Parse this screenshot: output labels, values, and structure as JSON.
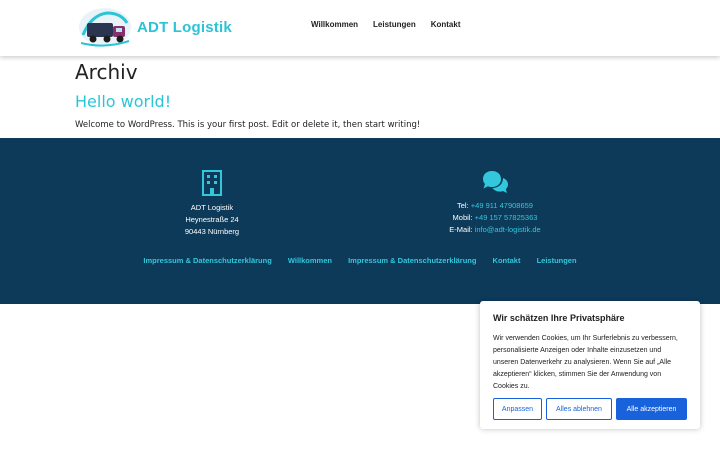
{
  "header": {
    "brand": "ADT Logistik",
    "nav": [
      {
        "label": "Willkommen"
      },
      {
        "label": "Leistungen"
      },
      {
        "label": "Kontakt"
      }
    ]
  },
  "main": {
    "page_title": "Archiv",
    "post_title": "Hello world!",
    "post_excerpt": "Welcome to WordPress. This is your first post. Edit or delete it, then start writing!"
  },
  "footer": {
    "address": {
      "icon": "building-icon",
      "company": "ADT Logistik",
      "street": "Heynestraße 24",
      "city": "90443 Nürnberg"
    },
    "contact": {
      "icon": "chat-icon",
      "tel_label": "Tel:",
      "tel": "+49 911 47908659",
      "mobil_label": "Mobil:",
      "mobil": "+49 157 57825363",
      "email_label": "E-Mail:",
      "email": "info@adt-logistik.de"
    },
    "links": [
      {
        "label": "Impressum & Datenschutzerklärung"
      },
      {
        "label": "Willkommen"
      },
      {
        "label": "Impressum & Datenschutzerklärung"
      },
      {
        "label": "Kontakt"
      },
      {
        "label": "Leistungen"
      }
    ],
    "colors": {
      "background": "#0e3a5a",
      "link": "#32c7db"
    }
  },
  "cookie": {
    "title": "Wir schätzen Ihre Privatsphäre",
    "text": "Wir verwenden Cookies, um Ihr Surferlebnis zu verbessern, personalisierte Anzeigen oder Inhalte einzusetzen und unseren Datenverkehr zu analysieren. Wenn Sie auf „Alle akzeptieren“ klicken, stimmen Sie der Anwendung von Cookies zu.",
    "buttons": {
      "customize": "Anpassen",
      "reject": "Alles ablehnen",
      "accept": "Alle akzeptieren"
    },
    "accent": "#1863dc"
  }
}
